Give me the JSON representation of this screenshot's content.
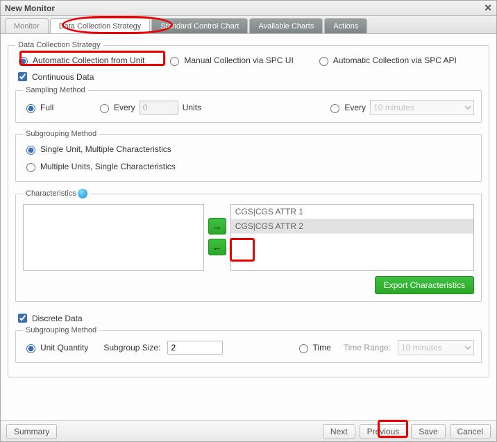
{
  "title": "New Monitor",
  "tabs": [
    "Monitor",
    "Data Collection Strategy",
    "Standard Control Chart",
    "Available Charts",
    "Actions"
  ],
  "activeTab": 1,
  "strategy": {
    "legend": "Data Collection Strategy",
    "modes": {
      "auto": "Automatic Collection from Unit",
      "manual": "Manual Collection via SPC UI",
      "api": "Automatic Collection via SPC API"
    },
    "continuous": {
      "label": "Continuous Data",
      "checked": true
    },
    "sampling": {
      "legend": "Sampling Method",
      "full": "Full",
      "everyUnits": "Every",
      "everyUnitsValue": "0",
      "unitsLabel": "Units",
      "everyTime": "Every",
      "timeValue": "10 minutes"
    },
    "subgroup1": {
      "legend": "Subgrouping Method",
      "opt1": "Single Unit, Multiple Characteristics",
      "opt2": "Multiple Units, Single Characteristics"
    },
    "characteristics": {
      "legend": "Characteristics",
      "right": [
        "CGS|CGS ATTR 1",
        "CGS|CGS ATTR 2"
      ],
      "export": "Export Characteristics"
    },
    "discrete": {
      "label": "Discrete Data",
      "checked": true
    },
    "subgroup2": {
      "legend": "Subgrouping Method",
      "unitQty": "Unit Quantity",
      "subgroupSizeLabel": "Subgroup Size:",
      "subgroupSizeValue": "2",
      "time": "Time",
      "timeRangeLabel": "Time Range:",
      "timeRangeValue": "10 minutes"
    }
  },
  "footer": {
    "summary": "Summary",
    "next": "Next",
    "previous": "Previous",
    "save": "Save",
    "cancel": "Cancel"
  }
}
